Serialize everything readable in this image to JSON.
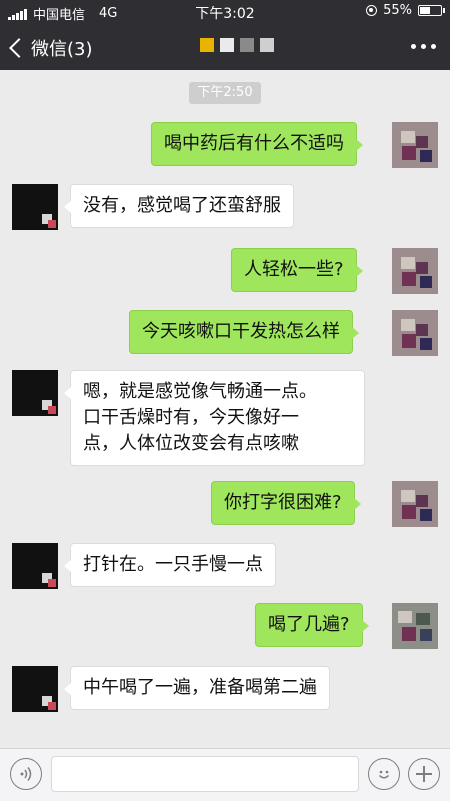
{
  "status_bar": {
    "carrier": "中国电信",
    "network": "4G",
    "time": "下午3:02",
    "battery": "55%",
    "battery_level": 0.55
  },
  "nav": {
    "back_label": "微信(3)"
  },
  "chat": {
    "timestamp": "下午2:50",
    "messages": [
      {
        "from": "me",
        "text": "喝中药后有什么不适吗"
      },
      {
        "from": "other",
        "text": "没有，感觉喝了还蛮舒服"
      },
      {
        "from": "me",
        "text": "人轻松一些?"
      },
      {
        "from": "me",
        "text": "今天咳嗽口干发热怎么样"
      },
      {
        "from": "other",
        "line1": "嗯，就是感觉像气畅通一点。",
        "line2": "口干舌燥时有，今天像好一",
        "line3": "点，人体位改变会有点咳嗽"
      },
      {
        "from": "me",
        "text": "你打字很困难?"
      },
      {
        "from": "other",
        "text": "打针在。一只手慢一点"
      },
      {
        "from": "me",
        "text": "喝了几遍?"
      },
      {
        "from": "other",
        "text": "中午喝了一遍，准备喝第二遍"
      }
    ]
  },
  "colors": {
    "header_bg": "#2f2f33",
    "chat_bg": "#ebebeb",
    "my_bubble": "#9fe65c",
    "their_bubble": "#ffffff"
  },
  "icons": {
    "voice": "voice-icon",
    "emoji": "emoji-icon",
    "add": "plus-icon",
    "more": "more-dots-icon",
    "back": "chevron-left-icon"
  }
}
